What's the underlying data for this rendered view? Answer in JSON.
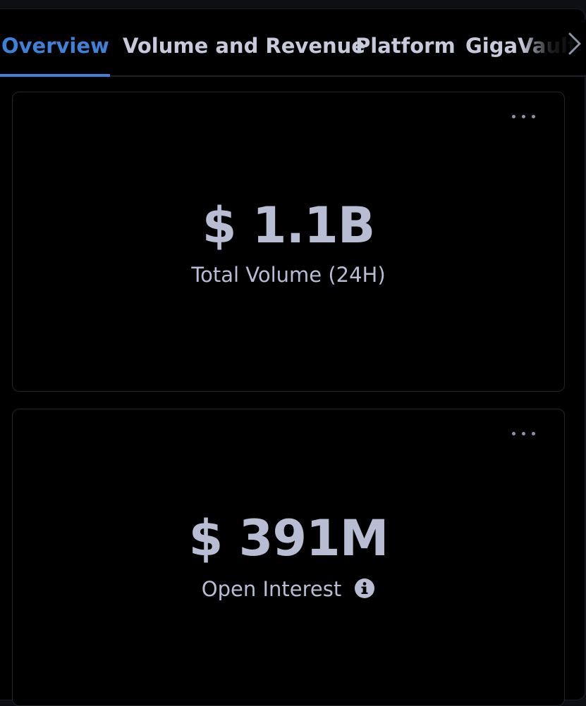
{
  "tabs": [
    {
      "label": "Overview",
      "active": true
    },
    {
      "label": "Volume and Revenue",
      "active": false
    },
    {
      "label": "Platform",
      "active": false
    },
    {
      "label": "GigaVault",
      "active": false
    }
  ],
  "colors": {
    "accent": "#3d82d8",
    "text": "#b8bdd3",
    "background": "#000000"
  },
  "cards": [
    {
      "value": "$ 1.1B",
      "label": "Total Volume (24H)",
      "menu_icon": "more-horizontal-icon"
    },
    {
      "value": "$ 391M",
      "label": "Open Interest",
      "menu_icon": "more-horizontal-icon",
      "info_icon": "info-icon"
    }
  ],
  "icons": {
    "scroll_right": "chevron-right-icon"
  }
}
